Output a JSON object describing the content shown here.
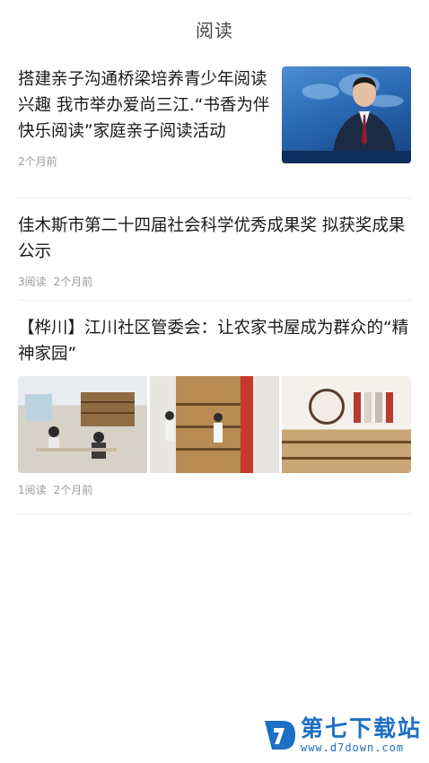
{
  "header": {
    "title": "阅读"
  },
  "articles": [
    {
      "headline": "搭建亲子沟通桥梁培养青少年阅读兴趣 我市举办爱尚三江.“书香为伴 快乐阅读”家庭亲子阅读活动",
      "reads": "",
      "time": "2个月前"
    },
    {
      "headline": "佳木斯市第二十四届社会科学优秀成果奖 拟获奖成果公示",
      "reads": "3阅读",
      "time": "2个月前"
    },
    {
      "headline": "【桦川】江川社区管委会：让农家书屋成为群众的“精神家园”",
      "reads": "1阅读",
      "time": "2个月前"
    }
  ],
  "watermark": {
    "title": "第七下载站",
    "url": "www.d7down.com"
  },
  "colors": {
    "brand": "#1d6fc4",
    "meta": "#999999"
  }
}
